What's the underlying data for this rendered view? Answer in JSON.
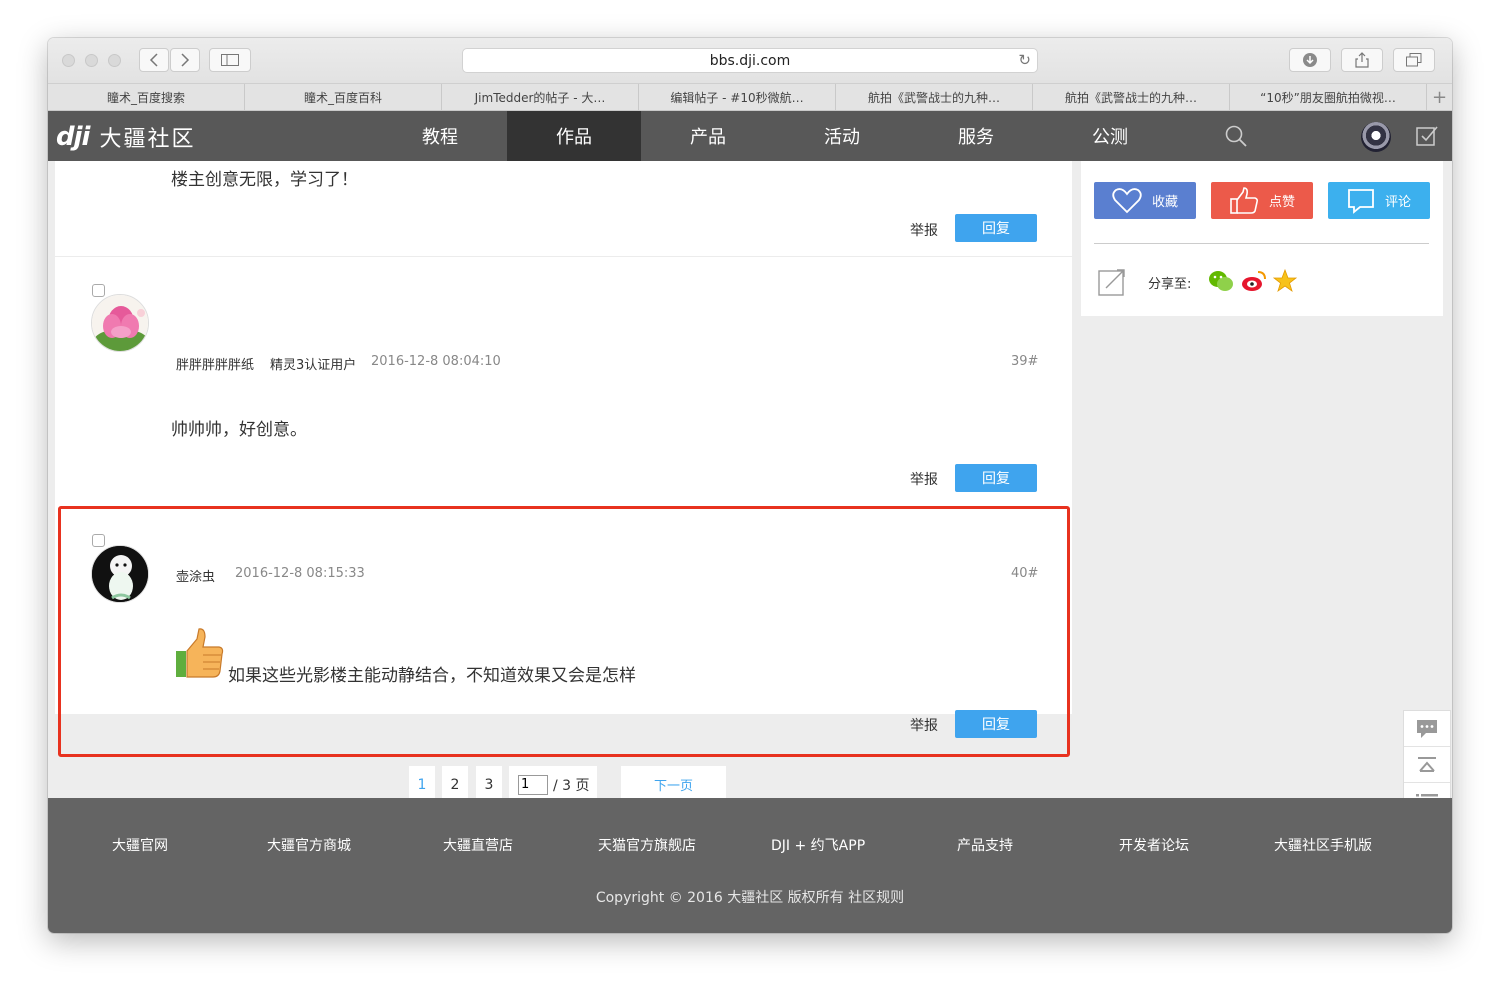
{
  "browser": {
    "url": "bbs.dji.com",
    "tabs": [
      "瞳术_百度搜索",
      "瞳术_百度百科",
      "JimTedder的帖子 - 大…",
      "编辑帖子 - #10秒微航…",
      "航拍《武警战士的九种…",
      "航拍《武警战士的九种…",
      "“10秒”朋友圈航拍微视…"
    ],
    "new_tab": "+"
  },
  "site": {
    "logo_mark": "dji",
    "logo_text": "大疆社区",
    "nav": [
      "教程",
      "作品",
      "产品",
      "活动",
      "服务",
      "公测"
    ],
    "active_nav": "作品"
  },
  "posts": {
    "first": {
      "text": "楼主创意无限，学习了！",
      "report": "举报",
      "reply": "回复"
    },
    "second": {
      "author": "胖胖胖胖胖纸",
      "badge": "精灵3认证用户",
      "time": "2016-12-8 08:04:10",
      "floor": "39#",
      "text": "帅帅帅，好创意。",
      "report": "举报",
      "reply": "回复"
    },
    "third": {
      "author": "壶涂虫",
      "time": "2016-12-8 08:15:33",
      "floor": "40#",
      "text": "如果这些光影楼主能动静结合，不知道效果又会是怎样",
      "report": "举报",
      "reply": "回复"
    }
  },
  "pagination": {
    "pages": [
      "1",
      "2",
      "3"
    ],
    "current": "1",
    "input_value": "1",
    "total": "/ 3 页",
    "next": "下一页"
  },
  "sidebar": {
    "favorite": "收藏",
    "like": "点赞",
    "comment": "评论",
    "share_label": "分享至:"
  },
  "footer": {
    "links": [
      "大疆官网",
      "大疆官方商城",
      "大疆直营店",
      "天猫官方旗舰店",
      "DJI + 约飞APP",
      "产品支持",
      "开发者论坛",
      "大疆社区手机版"
    ],
    "copyright": "Copyright © 2016 大疆社区 版权所有 社区规则"
  },
  "colors": {
    "nav_bg": "#585858",
    "favorite": "#5a7fd0",
    "like": "#ec5a4a",
    "comment": "#3cb0ee",
    "reply": "#3fa4ee",
    "highlight": "#e8321f",
    "footer_bg": "#646464"
  }
}
